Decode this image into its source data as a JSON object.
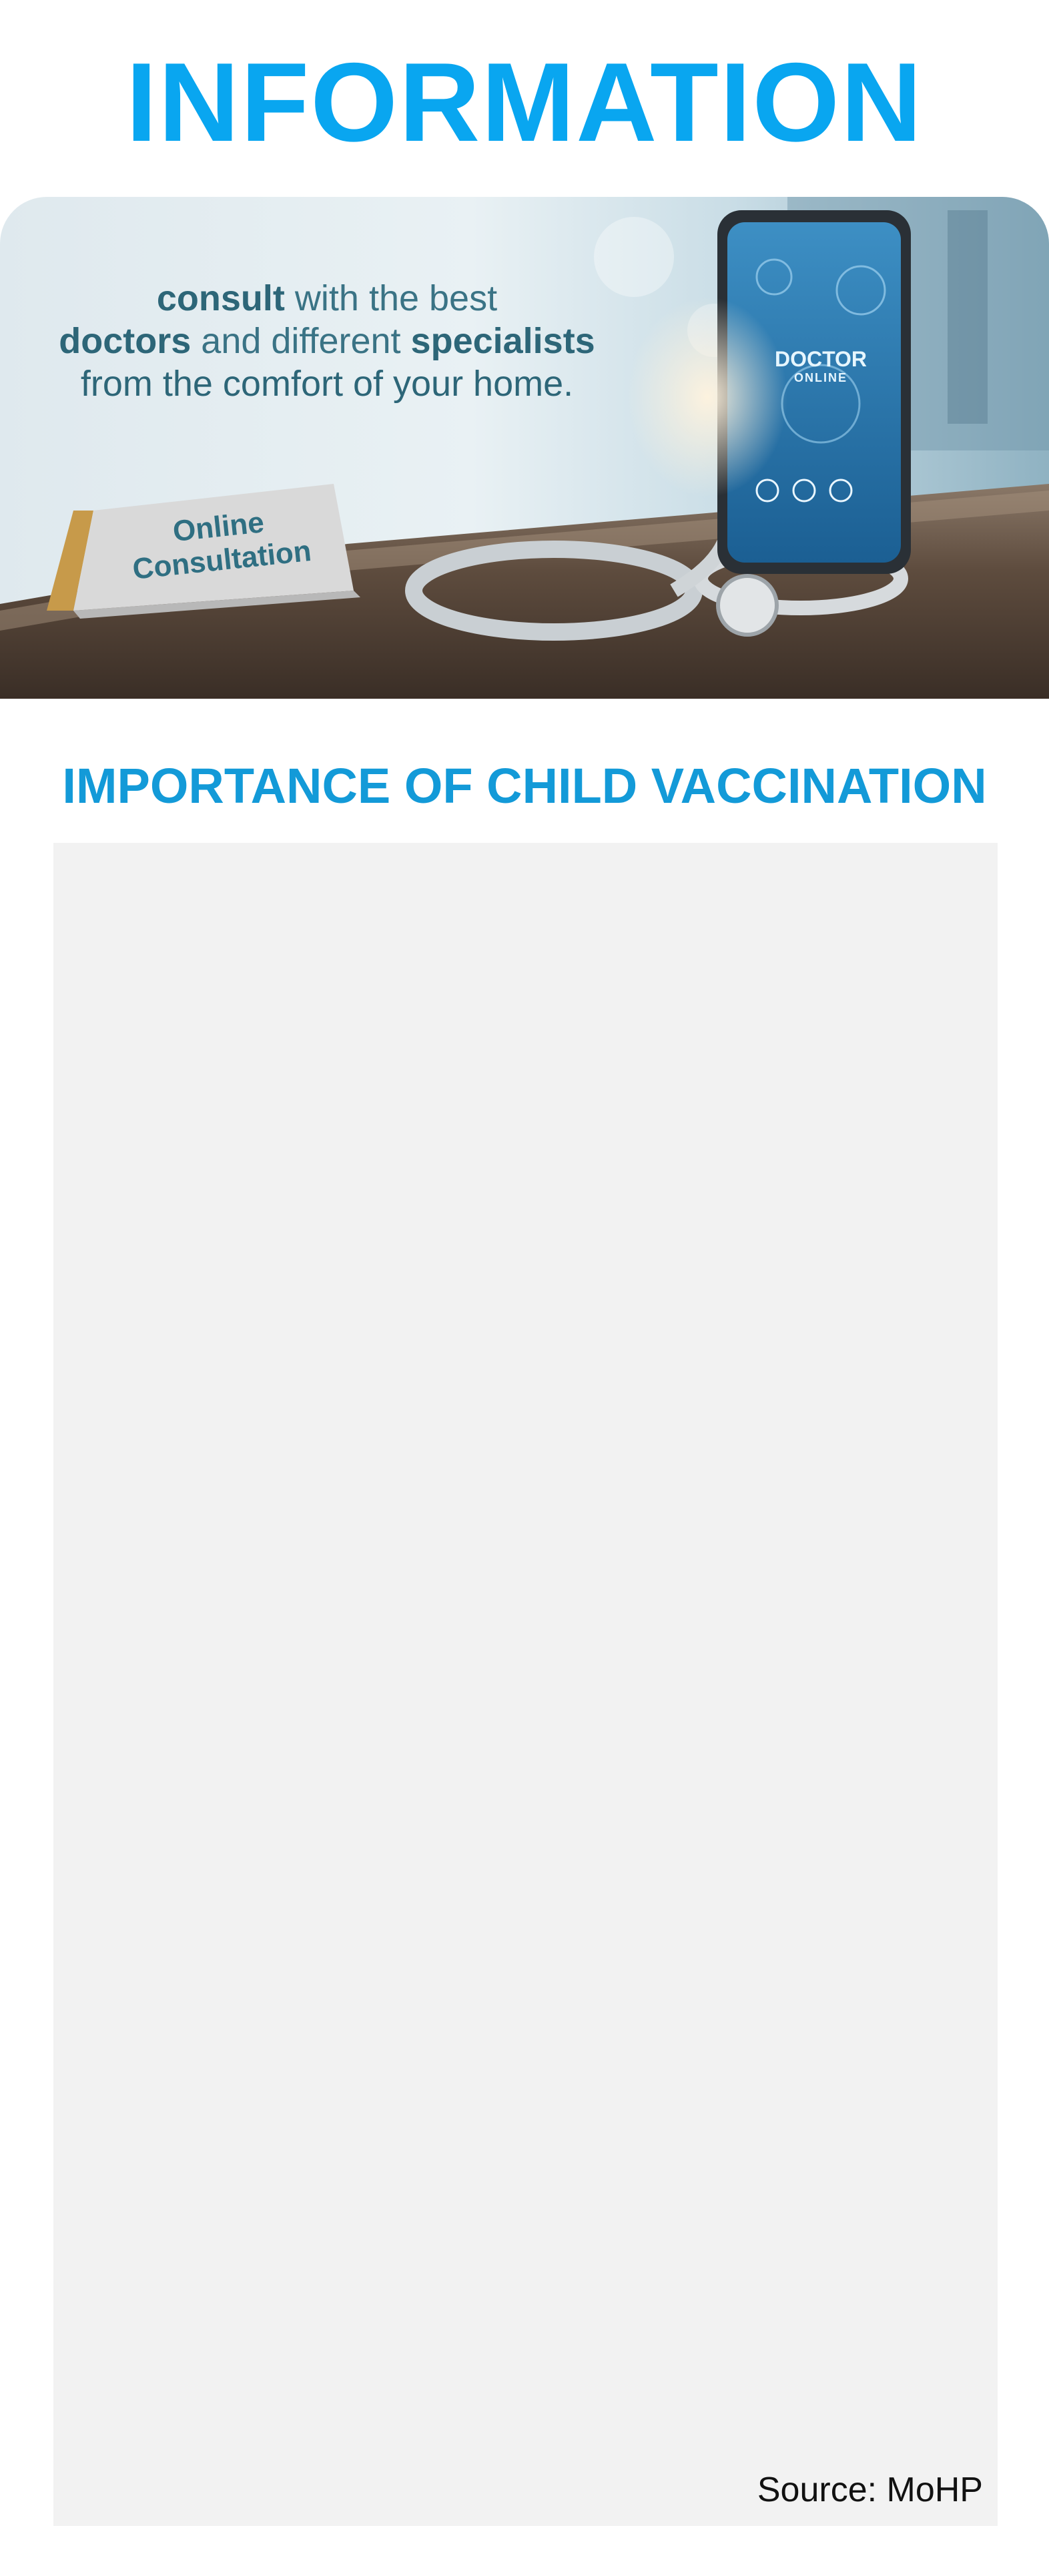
{
  "page": {
    "title": "INFORMATION",
    "section_title": "IMPORTANCE OF CHILD VACCINATION",
    "source": "Source: MoHP"
  },
  "banner": {
    "line1_bold": "consult",
    "line1_rest": " with the best",
    "line2_bold1": "doctors",
    "line2_mid": " and different ",
    "line2_bold2": "specialists",
    "line3": "from the comfort of your home.",
    "tent_line1": "Online",
    "tent_line2": "Consultation",
    "phone_big": "DOCTOR",
    "phone_small": "ONLINE"
  },
  "colors": {
    "title": "#09a6f0",
    "section_title": "#139ad8",
    "banner_text": "#2d6678",
    "content_bg": "#f2f2f2"
  }
}
